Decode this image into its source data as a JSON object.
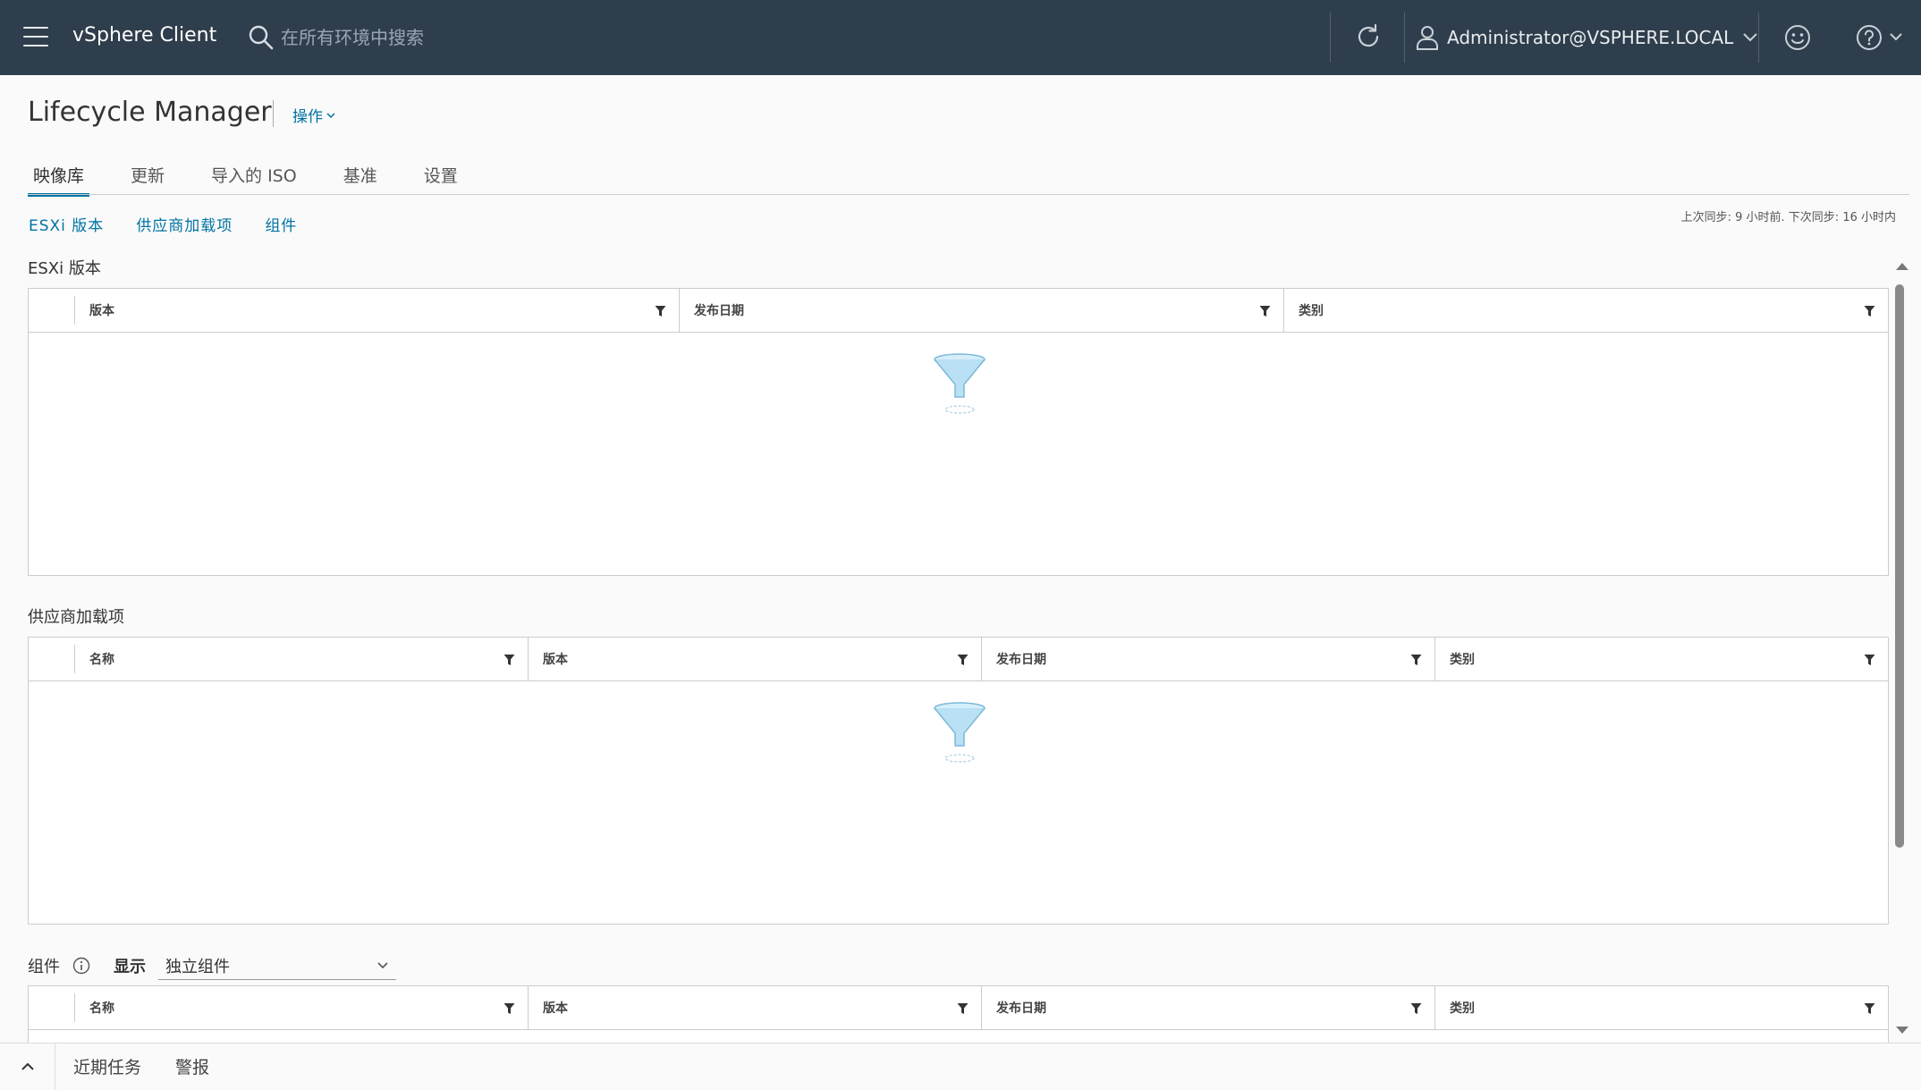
{
  "header": {
    "app_title": "vSphere Client",
    "search_placeholder": "在所有环境中搜索",
    "user_name": "Administrator@VSPHERE.LOCAL"
  },
  "page": {
    "title": "Lifecycle Manager",
    "actions_label": "操作"
  },
  "tabs": [
    {
      "label": "映像库",
      "active": true
    },
    {
      "label": "更新",
      "active": false
    },
    {
      "label": "导入的 ISO",
      "active": false
    },
    {
      "label": "基准",
      "active": false
    },
    {
      "label": "设置",
      "active": false
    }
  ],
  "sublinks": [
    "ESXi 版本",
    "供应商加载项",
    "组件"
  ],
  "sync_status": "上次同步: 9 小时前. 下次同步: 16 小时内",
  "sections": {
    "esxi": {
      "title": "ESXi 版本",
      "columns": [
        "版本",
        "发布日期",
        "类别"
      ]
    },
    "vendor": {
      "title": "供应商加载项",
      "columns": [
        "名称",
        "版本",
        "发布日期",
        "类别"
      ]
    },
    "components": {
      "title": "组件",
      "show_label": "显示",
      "show_value": "独立组件",
      "columns": [
        "名称",
        "版本",
        "发布日期",
        "类别"
      ]
    }
  },
  "bottom_bar": {
    "recent_tasks": "近期任务",
    "alarms": "警报"
  },
  "colors": {
    "header_bg": "#2f3e4c",
    "accent": "#0072a3"
  }
}
